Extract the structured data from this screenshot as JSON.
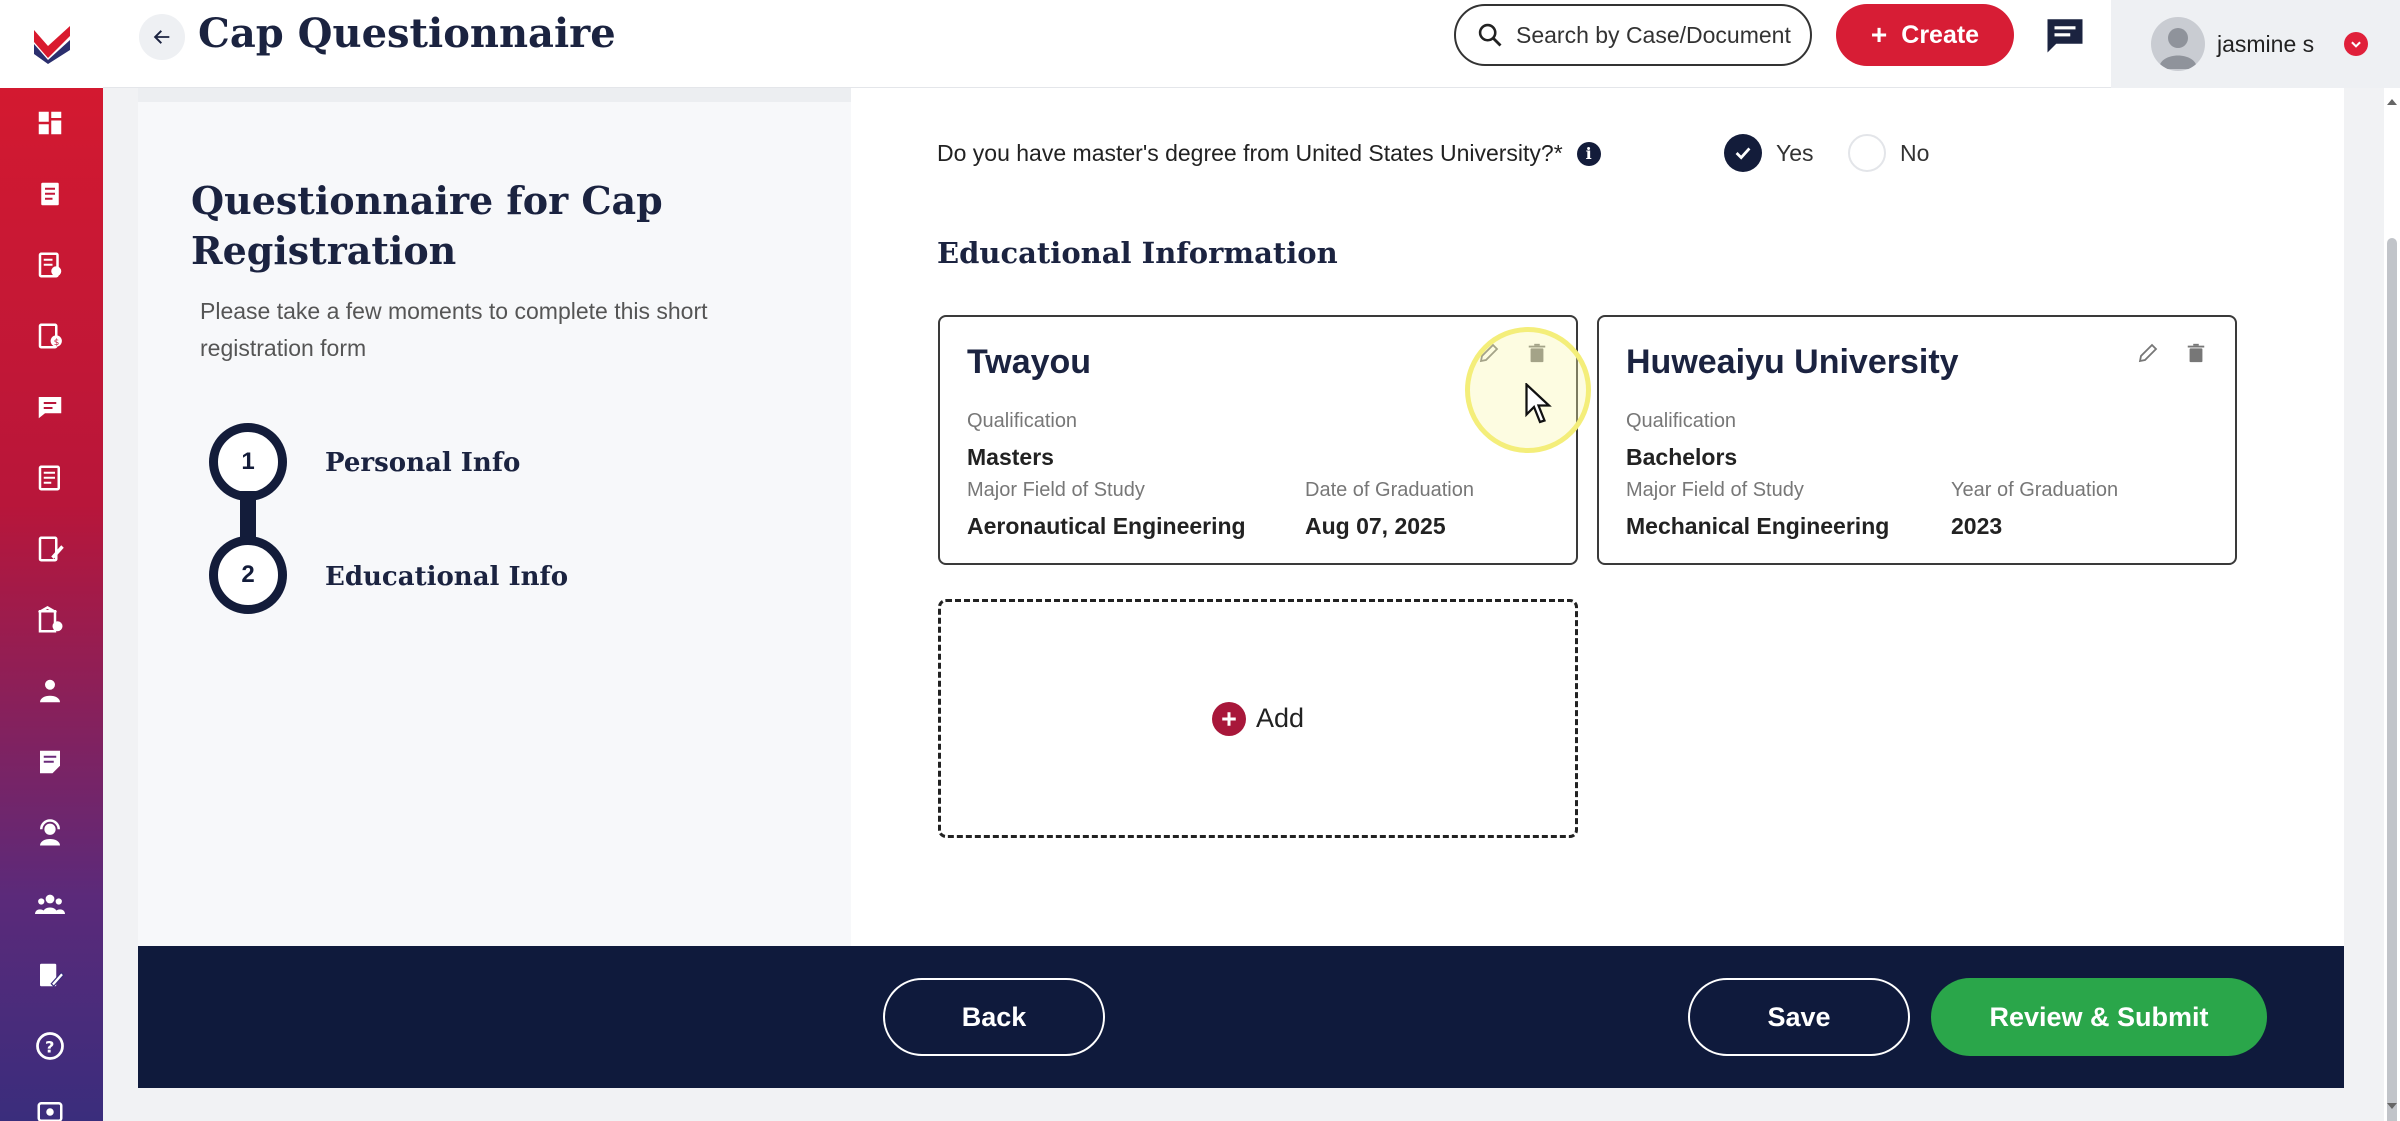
{
  "header": {
    "title": "Cap Questionnaire",
    "search_placeholder": "Search by Case/Document",
    "create_label": "Create",
    "user_name": "jasmine s"
  },
  "intro": {
    "title": "Questionnaire for Cap Registration",
    "subtitle": "Please take a few moments to complete this short registration form"
  },
  "steps": [
    {
      "number": "1",
      "label": "Personal Info"
    },
    {
      "number": "2",
      "label": "Educational Info"
    }
  ],
  "question": {
    "text": "Do you have master's degree from United States University?*",
    "options": [
      {
        "label": "Yes",
        "selected": true
      },
      {
        "label": "No",
        "selected": false
      }
    ]
  },
  "education": {
    "section_title": "Educational Information",
    "cards": [
      {
        "school": "Twayou",
        "qualification_label": "Qualification",
        "qualification": "Masters",
        "major_label": "Major Field of Study",
        "major": "Aeronautical Engineering",
        "date_label": "Date of Graduation",
        "date": "Aug 07, 2025"
      },
      {
        "school": "Huweaiyu University",
        "qualification_label": "Qualification",
        "qualification": "Bachelors",
        "major_label": "Major Field of Study",
        "major": "Mechanical Engineering",
        "date_label": "Year of Graduation",
        "date": "2023"
      }
    ],
    "add_label": "Add"
  },
  "footer": {
    "back_label": "Back",
    "save_label": "Save",
    "submit_label": "Review & Submit"
  },
  "colors": {
    "brand_red": "#d71d35",
    "navy": "#0f1a3c",
    "submit_green": "#2aa64a"
  },
  "icons": {
    "sidebar": [
      "dashboard-icon",
      "document-icon",
      "checklist-icon",
      "form-icon",
      "chat-icon",
      "report-icon",
      "edit-doc-icon",
      "building-icon",
      "person-icon",
      "note-icon",
      "support-agent-icon",
      "group-icon",
      "edit-form-icon",
      "help-icon",
      "id-card-icon"
    ]
  }
}
